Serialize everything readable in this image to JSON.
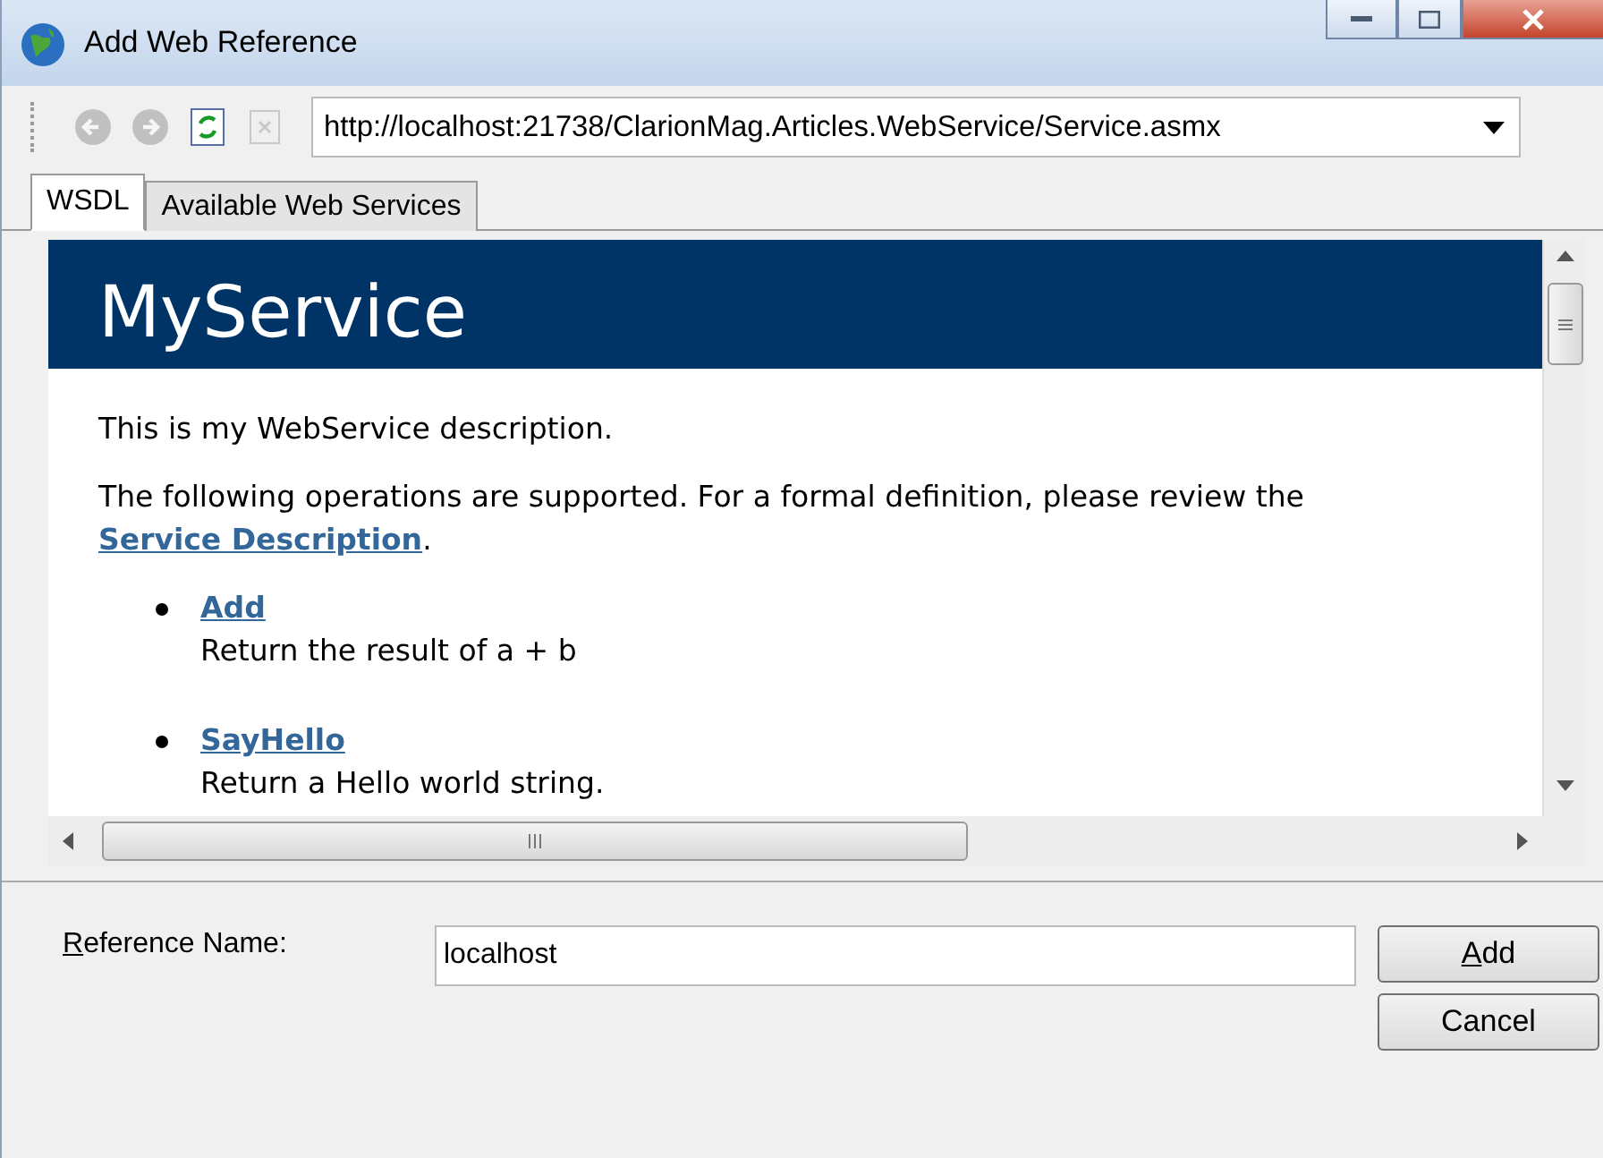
{
  "window": {
    "title": "Add Web Reference"
  },
  "toolbar": {
    "buttons": [
      {
        "kind": "back",
        "disabled": true
      },
      {
        "kind": "forward",
        "disabled": true
      },
      {
        "kind": "refresh",
        "disabled": false
      },
      {
        "kind": "stop",
        "disabled": true
      }
    ],
    "address": "http://localhost:21738/ClarionMag.Articles.WebService/Service.asmx"
  },
  "tabs": [
    {
      "label": "WSDL",
      "selected": true
    },
    {
      "label": "Available Web Services",
      "selected": false
    }
  ],
  "page": {
    "heading": "MyService",
    "description": "This is my WebService description.",
    "intro": "The following operations are supported. For a formal definition, please review the ",
    "intro_link": "Service Description",
    "intro_end": ".",
    "operations": [
      {
        "name": "Add",
        "description": "Return the result of a + b"
      },
      {
        "name": "SayHello",
        "description": "Return a Hello world string."
      }
    ]
  },
  "reference_name": {
    "label": "Reference Name:",
    "value": "localhost"
  },
  "buttons": [
    {
      "label": "Add",
      "mnemonic": true
    },
    {
      "label": "Cancel",
      "mnemonic": false
    }
  ]
}
